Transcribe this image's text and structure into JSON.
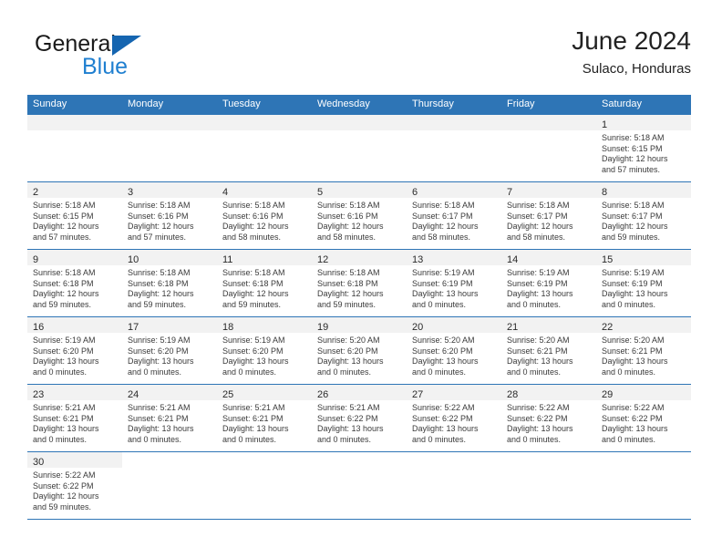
{
  "brand": {
    "word1": "General",
    "word2": "Blue",
    "triangle_color": "#1565b0",
    "blue_color": "#1f7fd0"
  },
  "header": {
    "title": "June 2024",
    "subtitle": "Sulaco, Honduras"
  },
  "colors": {
    "header_blue": "#2e75b6",
    "daynum_strip": "#f2f2f2",
    "grid_line": "#2e75b6"
  },
  "weekdays": [
    "Sunday",
    "Monday",
    "Tuesday",
    "Wednesday",
    "Thursday",
    "Friday",
    "Saturday"
  ],
  "weeks": [
    [
      {
        "day": "",
        "lines": []
      },
      {
        "day": "",
        "lines": []
      },
      {
        "day": "",
        "lines": []
      },
      {
        "day": "",
        "lines": []
      },
      {
        "day": "",
        "lines": []
      },
      {
        "day": "",
        "lines": []
      },
      {
        "day": "1",
        "lines": [
          "Sunrise: 5:18 AM",
          "Sunset: 6:15 PM",
          "Daylight: 12 hours",
          "and 57 minutes."
        ]
      }
    ],
    [
      {
        "day": "2",
        "lines": [
          "Sunrise: 5:18 AM",
          "Sunset: 6:15 PM",
          "Daylight: 12 hours",
          "and 57 minutes."
        ]
      },
      {
        "day": "3",
        "lines": [
          "Sunrise: 5:18 AM",
          "Sunset: 6:16 PM",
          "Daylight: 12 hours",
          "and 57 minutes."
        ]
      },
      {
        "day": "4",
        "lines": [
          "Sunrise: 5:18 AM",
          "Sunset: 6:16 PM",
          "Daylight: 12 hours",
          "and 58 minutes."
        ]
      },
      {
        "day": "5",
        "lines": [
          "Sunrise: 5:18 AM",
          "Sunset: 6:16 PM",
          "Daylight: 12 hours",
          "and 58 minutes."
        ]
      },
      {
        "day": "6",
        "lines": [
          "Sunrise: 5:18 AM",
          "Sunset: 6:17 PM",
          "Daylight: 12 hours",
          "and 58 minutes."
        ]
      },
      {
        "day": "7",
        "lines": [
          "Sunrise: 5:18 AM",
          "Sunset: 6:17 PM",
          "Daylight: 12 hours",
          "and 58 minutes."
        ]
      },
      {
        "day": "8",
        "lines": [
          "Sunrise: 5:18 AM",
          "Sunset: 6:17 PM",
          "Daylight: 12 hours",
          "and 59 minutes."
        ]
      }
    ],
    [
      {
        "day": "9",
        "lines": [
          "Sunrise: 5:18 AM",
          "Sunset: 6:18 PM",
          "Daylight: 12 hours",
          "and 59 minutes."
        ]
      },
      {
        "day": "10",
        "lines": [
          "Sunrise: 5:18 AM",
          "Sunset: 6:18 PM",
          "Daylight: 12 hours",
          "and 59 minutes."
        ]
      },
      {
        "day": "11",
        "lines": [
          "Sunrise: 5:18 AM",
          "Sunset: 6:18 PM",
          "Daylight: 12 hours",
          "and 59 minutes."
        ]
      },
      {
        "day": "12",
        "lines": [
          "Sunrise: 5:18 AM",
          "Sunset: 6:18 PM",
          "Daylight: 12 hours",
          "and 59 minutes."
        ]
      },
      {
        "day": "13",
        "lines": [
          "Sunrise: 5:19 AM",
          "Sunset: 6:19 PM",
          "Daylight: 13 hours",
          "and 0 minutes."
        ]
      },
      {
        "day": "14",
        "lines": [
          "Sunrise: 5:19 AM",
          "Sunset: 6:19 PM",
          "Daylight: 13 hours",
          "and 0 minutes."
        ]
      },
      {
        "day": "15",
        "lines": [
          "Sunrise: 5:19 AM",
          "Sunset: 6:19 PM",
          "Daylight: 13 hours",
          "and 0 minutes."
        ]
      }
    ],
    [
      {
        "day": "16",
        "lines": [
          "Sunrise: 5:19 AM",
          "Sunset: 6:20 PM",
          "Daylight: 13 hours",
          "and 0 minutes."
        ]
      },
      {
        "day": "17",
        "lines": [
          "Sunrise: 5:19 AM",
          "Sunset: 6:20 PM",
          "Daylight: 13 hours",
          "and 0 minutes."
        ]
      },
      {
        "day": "18",
        "lines": [
          "Sunrise: 5:19 AM",
          "Sunset: 6:20 PM",
          "Daylight: 13 hours",
          "and 0 minutes."
        ]
      },
      {
        "day": "19",
        "lines": [
          "Sunrise: 5:20 AM",
          "Sunset: 6:20 PM",
          "Daylight: 13 hours",
          "and 0 minutes."
        ]
      },
      {
        "day": "20",
        "lines": [
          "Sunrise: 5:20 AM",
          "Sunset: 6:20 PM",
          "Daylight: 13 hours",
          "and 0 minutes."
        ]
      },
      {
        "day": "21",
        "lines": [
          "Sunrise: 5:20 AM",
          "Sunset: 6:21 PM",
          "Daylight: 13 hours",
          "and 0 minutes."
        ]
      },
      {
        "day": "22",
        "lines": [
          "Sunrise: 5:20 AM",
          "Sunset: 6:21 PM",
          "Daylight: 13 hours",
          "and 0 minutes."
        ]
      }
    ],
    [
      {
        "day": "23",
        "lines": [
          "Sunrise: 5:21 AM",
          "Sunset: 6:21 PM",
          "Daylight: 13 hours",
          "and 0 minutes."
        ]
      },
      {
        "day": "24",
        "lines": [
          "Sunrise: 5:21 AM",
          "Sunset: 6:21 PM",
          "Daylight: 13 hours",
          "and 0 minutes."
        ]
      },
      {
        "day": "25",
        "lines": [
          "Sunrise: 5:21 AM",
          "Sunset: 6:21 PM",
          "Daylight: 13 hours",
          "and 0 minutes."
        ]
      },
      {
        "day": "26",
        "lines": [
          "Sunrise: 5:21 AM",
          "Sunset: 6:22 PM",
          "Daylight: 13 hours",
          "and 0 minutes."
        ]
      },
      {
        "day": "27",
        "lines": [
          "Sunrise: 5:22 AM",
          "Sunset: 6:22 PM",
          "Daylight: 13 hours",
          "and 0 minutes."
        ]
      },
      {
        "day": "28",
        "lines": [
          "Sunrise: 5:22 AM",
          "Sunset: 6:22 PM",
          "Daylight: 13 hours",
          "and 0 minutes."
        ]
      },
      {
        "day": "29",
        "lines": [
          "Sunrise: 5:22 AM",
          "Sunset: 6:22 PM",
          "Daylight: 13 hours",
          "and 0 minutes."
        ]
      }
    ],
    [
      {
        "day": "30",
        "lines": [
          "Sunrise: 5:22 AM",
          "Sunset: 6:22 PM",
          "Daylight: 12 hours",
          "and 59 minutes."
        ]
      },
      {
        "day": "",
        "lines": []
      },
      {
        "day": "",
        "lines": []
      },
      {
        "day": "",
        "lines": []
      },
      {
        "day": "",
        "lines": []
      },
      {
        "day": "",
        "lines": []
      },
      {
        "day": "",
        "lines": []
      }
    ]
  ]
}
